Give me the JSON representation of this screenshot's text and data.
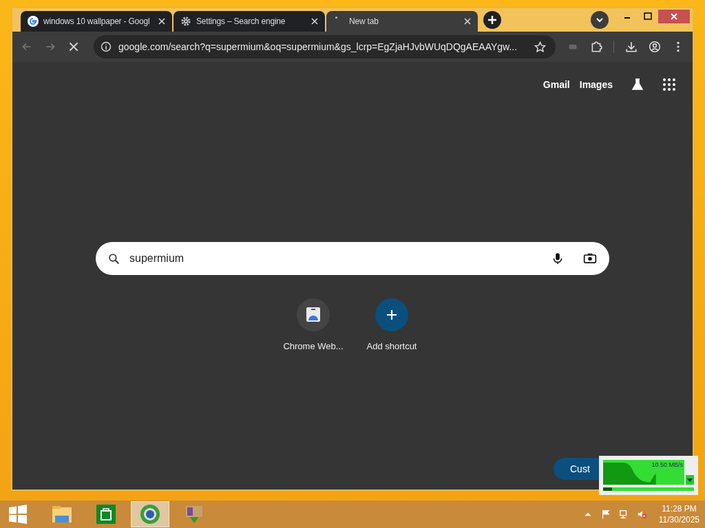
{
  "tabs": [
    {
      "title": "windows 10 wallpaper - Googl",
      "kind": "google",
      "selected": false
    },
    {
      "title": "Settings – Search engine",
      "kind": "gear",
      "selected": false
    },
    {
      "title": "New tab",
      "kind": "loading",
      "selected": true
    }
  ],
  "address": {
    "url": "google.com/search?q=supermium&oq=supermium&gs_lcrp=EgZjaHJvbWUqDQgAEAAYgw..."
  },
  "top_links": [
    "Gmail",
    "Images"
  ],
  "search": {
    "value": "supermium"
  },
  "shortcuts": [
    {
      "label": "Chrome Web...",
      "kind": "site"
    },
    {
      "label": "Add shortcut",
      "kind": "add"
    }
  ],
  "customize": {
    "label": "Cust"
  },
  "net_meter": {
    "reading": "10.50 MB/s",
    "level": 0.1
  },
  "taskbar": {
    "apps": [
      {
        "kind": "explorer",
        "selected": false
      },
      {
        "kind": "store",
        "selected": false
      },
      {
        "kind": "browser",
        "selected": true
      },
      {
        "kind": "installer",
        "selected": false
      }
    ]
  },
  "clock": {
    "time": "11:28 PM",
    "date": "11/30/2025"
  }
}
